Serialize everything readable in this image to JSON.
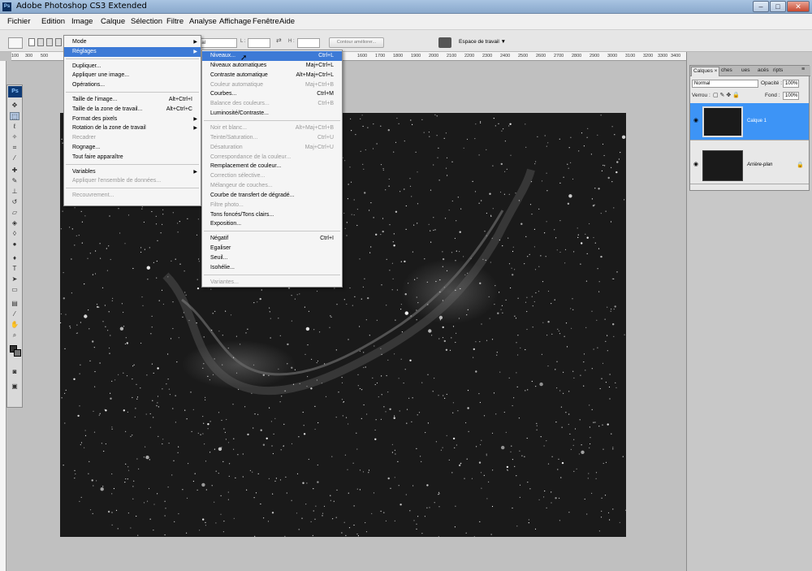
{
  "window": {
    "title": "Adobe Photoshop CS3 Extended",
    "app_icon": "Ps"
  },
  "window_controls": {
    "minimize": "–",
    "maximize": "□",
    "close": "✕"
  },
  "menubar": [
    "Fichier",
    "Edition",
    "Image",
    "Calque",
    "Sélection",
    "Filtre",
    "Analyse",
    "Affichage",
    "Fenêtre",
    "Aide"
  ],
  "options_bar": {
    "mode_value": "nal",
    "l_label": "L :",
    "h_label": "H :",
    "refine_button": "Contour améliorer...",
    "workspace_label": "Espace de travail ▼"
  },
  "ruler": [
    "100",
    "300",
    "500",
    "1600",
    "1700",
    "1800",
    "1900",
    "2000",
    "2100",
    "2200",
    "2300",
    "2400",
    "2500",
    "2600",
    "2700",
    "2800",
    "2900",
    "3000",
    "3100",
    "3200",
    "3300",
    "3400",
    "3500"
  ],
  "image_menu": {
    "items": [
      {
        "label": "Mode",
        "shortcut": "",
        "submenu": true,
        "disabled": false,
        "highlight": false
      },
      {
        "label": "Réglages",
        "shortcut": "",
        "submenu": true,
        "disabled": false,
        "highlight": true
      },
      {
        "label": "Dupliquer...",
        "shortcut": "",
        "submenu": false,
        "disabled": false,
        "highlight": false
      },
      {
        "label": "Appliquer une image...",
        "shortcut": "",
        "submenu": false,
        "disabled": false,
        "highlight": false
      },
      {
        "label": "Opérations...",
        "shortcut": "",
        "submenu": false,
        "disabled": false,
        "highlight": false
      },
      {
        "label": "Taille de l'image...",
        "shortcut": "Alt+Ctrl+I",
        "submenu": false,
        "disabled": false,
        "highlight": false
      },
      {
        "label": "Taille de la zone de travail...",
        "shortcut": "Alt+Ctrl+C",
        "submenu": false,
        "disabled": false,
        "highlight": false
      },
      {
        "label": "Format des pixels",
        "shortcut": "",
        "submenu": true,
        "disabled": false,
        "highlight": false
      },
      {
        "label": "Rotation de la zone de travail",
        "shortcut": "",
        "submenu": true,
        "disabled": false,
        "highlight": false
      },
      {
        "label": "Recadrer",
        "shortcut": "",
        "submenu": false,
        "disabled": true,
        "highlight": false
      },
      {
        "label": "Rognage...",
        "shortcut": "",
        "submenu": false,
        "disabled": false,
        "highlight": false
      },
      {
        "label": "Tout faire apparaître",
        "shortcut": "",
        "submenu": false,
        "disabled": false,
        "highlight": false
      },
      {
        "label": "Variables",
        "shortcut": "",
        "submenu": true,
        "disabled": false,
        "highlight": false
      },
      {
        "label": "Appliquer l'ensemble de données...",
        "shortcut": "",
        "submenu": false,
        "disabled": true,
        "highlight": false
      },
      {
        "label": "Recouvrement...",
        "shortcut": "",
        "submenu": false,
        "disabled": true,
        "highlight": false
      }
    ]
  },
  "adjustments_menu": {
    "items": [
      {
        "label": "Niveaux...",
        "shortcut": "Ctrl+L",
        "disabled": false,
        "highlight": true
      },
      {
        "label": "Niveaux automatiques",
        "shortcut": "Maj+Ctrl+L",
        "disabled": false,
        "highlight": false
      },
      {
        "label": "Contraste automatique",
        "shortcut": "Alt+Maj+Ctrl+L",
        "disabled": false,
        "highlight": false
      },
      {
        "label": "Couleur automatique",
        "shortcut": "Maj+Ctrl+B",
        "disabled": true,
        "highlight": false
      },
      {
        "label": "Courbes...",
        "shortcut": "Ctrl+M",
        "disabled": false,
        "highlight": false
      },
      {
        "label": "Balance des couleurs...",
        "shortcut": "Ctrl+B",
        "disabled": true,
        "highlight": false
      },
      {
        "label": "Luminosité/Contraste...",
        "shortcut": "",
        "disabled": false,
        "highlight": false
      },
      {
        "label": "Noir et blanc...",
        "shortcut": "Alt+Maj+Ctrl+B",
        "disabled": true,
        "highlight": false
      },
      {
        "label": "Teinte/Saturation...",
        "shortcut": "Ctrl+U",
        "disabled": true,
        "highlight": false
      },
      {
        "label": "Désaturation",
        "shortcut": "Maj+Ctrl+U",
        "disabled": true,
        "highlight": false
      },
      {
        "label": "Correspondance de la couleur...",
        "shortcut": "",
        "disabled": true,
        "highlight": false
      },
      {
        "label": "Remplacement de couleur...",
        "shortcut": "",
        "disabled": false,
        "highlight": false
      },
      {
        "label": "Correction sélective...",
        "shortcut": "",
        "disabled": true,
        "highlight": false
      },
      {
        "label": "Mélangeur de couches...",
        "shortcut": "",
        "disabled": true,
        "highlight": false
      },
      {
        "label": "Courbe de transfert de dégradé...",
        "shortcut": "",
        "disabled": false,
        "highlight": false
      },
      {
        "label": "Filtre photo...",
        "shortcut": "",
        "disabled": true,
        "highlight": false
      },
      {
        "label": "Tons foncés/Tons clairs...",
        "shortcut": "",
        "disabled": false,
        "highlight": false
      },
      {
        "label": "Exposition...",
        "shortcut": "",
        "disabled": false,
        "highlight": false
      },
      {
        "label": "Négatif",
        "shortcut": "Ctrl+I",
        "disabled": false,
        "highlight": false
      },
      {
        "label": "Egaliser",
        "shortcut": "",
        "disabled": false,
        "highlight": false
      },
      {
        "label": "Seuil...",
        "shortcut": "",
        "disabled": false,
        "highlight": false
      },
      {
        "label": "Isohélie...",
        "shortcut": "",
        "disabled": false,
        "highlight": false
      },
      {
        "label": "Variantes...",
        "shortcut": "",
        "disabled": true,
        "highlight": false
      }
    ]
  },
  "layers_panel": {
    "tabs": [
      "Calques ×",
      "ches",
      "ues",
      "acés",
      "ripts"
    ],
    "blend_mode": "Normal",
    "opacity_label": "Opacité :",
    "opacity_value": "100%",
    "lock_label": "Verrou :",
    "fill_label": "Fond :",
    "fill_value": "100%",
    "layers": [
      {
        "name": "Calque 1",
        "selected": true,
        "locked": false
      },
      {
        "name": "Arrière-plan",
        "selected": false,
        "locked": true
      }
    ]
  },
  "colors": {
    "accent": "#3d7ad6",
    "layer_selected": "#3d94f6",
    "canvas_bg": "#1a1a1a"
  }
}
